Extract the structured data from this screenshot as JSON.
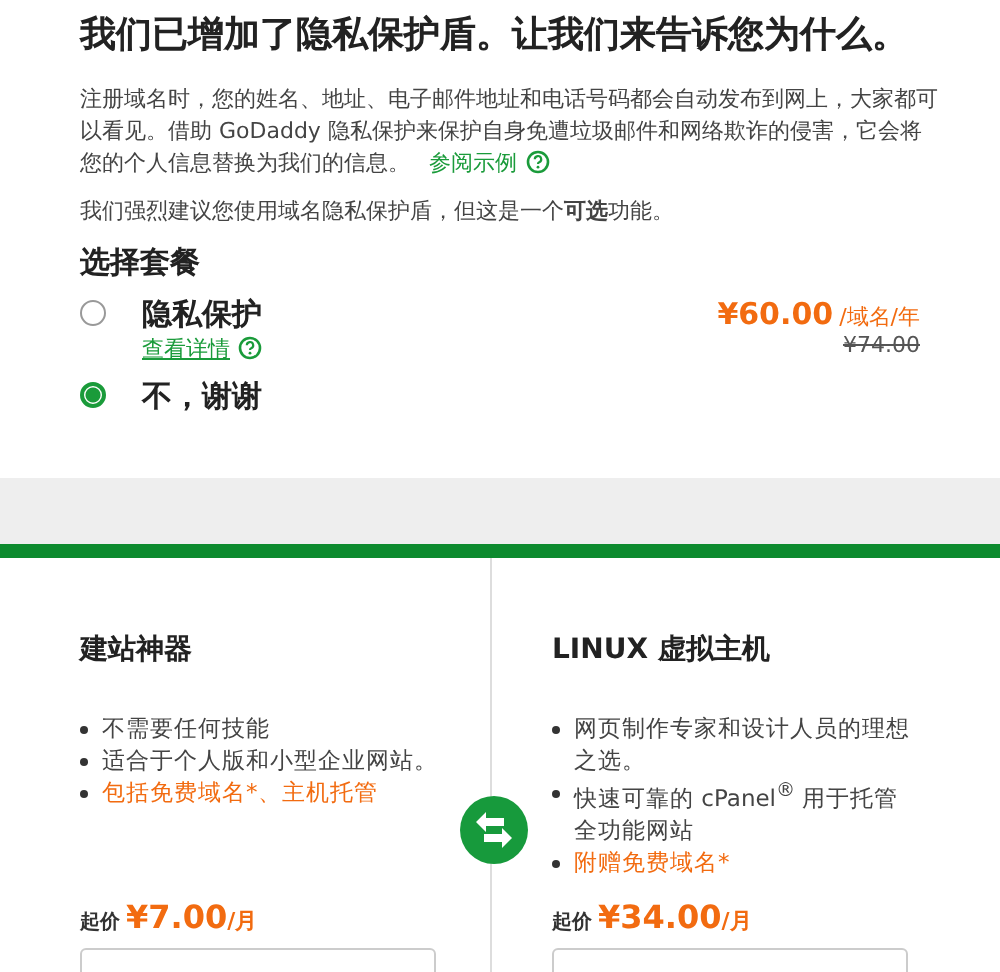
{
  "heading": "我们已增加了隐私保护盾。让我们来告诉您为什么。",
  "intro": {
    "text": "注册域名时，您的姓名、地址、电子邮件地址和电话号码都会自动发布到网上，大家都可以看见。借助 GoDaddy 隐私保护来保护自身免遭垃圾邮件和网络欺诈的侵害，它会将您的个人信息替换为我们的信息。",
    "link": "参阅示例"
  },
  "recommendation": "我们强烈建议您使用域名隐私保护盾，但这是一个**可选**功能。",
  "plan_section": {
    "title": "选择套餐",
    "options": [
      {
        "label": "隐私保护",
        "selected": false,
        "link": "查看详情",
        "price": "¥60.00",
        "unit": "/域名/年",
        "old_price": "¥74.00"
      },
      {
        "label": "不，谢谢",
        "selected": true
      }
    ]
  },
  "products": [
    {
      "title": "建站神器",
      "features": [
        {
          "text": "不需要任何技能",
          "highlight": false
        },
        {
          "text": "适合于个人版和小型企业网站。",
          "highlight": false
        },
        {
          "text": "包括免费域名*、主机托管",
          "highlight": true
        }
      ],
      "price_prefix": "起价",
      "price": "¥7.00",
      "unit": "/月"
    },
    {
      "title": "LINUX 虚拟主机",
      "features": [
        {
          "text": "网页制作专家和设计人员的理想之选。",
          "highlight": false
        },
        {
          "text": "快速可靠的 cPanel$^{®}$ 用于托管全功能网站",
          "highlight": false
        },
        {
          "text": "附赠免费域名*",
          "highlight": true
        }
      ],
      "price_prefix": "起价",
      "price": "¥34.00",
      "unit": "/月"
    }
  ]
}
